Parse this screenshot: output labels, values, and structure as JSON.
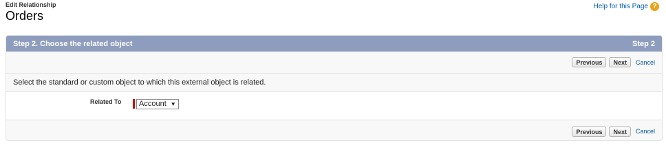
{
  "header": {
    "subtitle": "Edit Relationship",
    "title": "Orders",
    "help_label": "Help for this Page",
    "help_icon": "help-icon"
  },
  "panel": {
    "title": "Step 2. Choose the related object",
    "step": "Step 2",
    "header_color": "#8e9dbe"
  },
  "buttons": {
    "previous": "Previous",
    "next": "Next",
    "cancel": "Cancel"
  },
  "instructions": "Select the standard or custom object to which this external object is related.",
  "field": {
    "label": "Related To",
    "selected": "Account",
    "arrow": "▼"
  }
}
